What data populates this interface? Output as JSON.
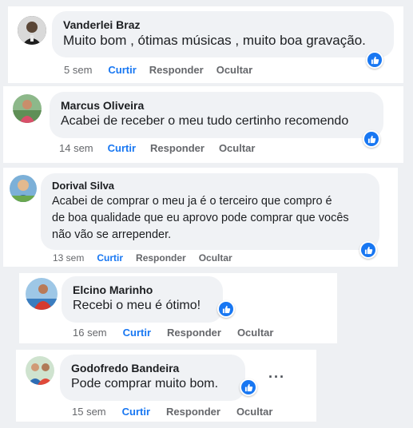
{
  "comments": [
    {
      "author": "Vanderlei Braz",
      "text": "Muito bom , ótimas músicas , muito boa gravação.",
      "time": "5 sem",
      "like": "Curtir",
      "reply": "Responder",
      "hide": "Ocultar"
    },
    {
      "author": "Marcus Oliveira",
      "text": "Acabei de receber o meu tudo certinho recomendo",
      "time": "14 sem",
      "like": "Curtir",
      "reply": "Responder",
      "hide": "Ocultar"
    },
    {
      "author": "Dorival Silva",
      "text_lines": [
        "Acabei de comprar o meu ja é o terceiro que compro é",
        "de boa qualidade que eu aprovo pode comprar que vocês",
        "não vão se arrepender."
      ],
      "time": "13 sem",
      "like": "Curtir",
      "reply": "Responder",
      "hide": "Ocultar"
    },
    {
      "author": "Elcino Marinho",
      "text": "Recebi o meu é ótimo!",
      "time": "16 sem",
      "like": "Curtir",
      "reply": "Responder",
      "hide": "Ocultar"
    },
    {
      "author": "Godofredo Bandeira",
      "text": "Pode comprar muito bom.",
      "time": "15 sem",
      "like": "Curtir",
      "reply": "Responder",
      "hide": "Ocultar",
      "more": "···"
    }
  ],
  "colors": {
    "like_blue": "#1877f2",
    "bubble_gray": "#f0f2f5",
    "meta_gray": "#65676b"
  }
}
